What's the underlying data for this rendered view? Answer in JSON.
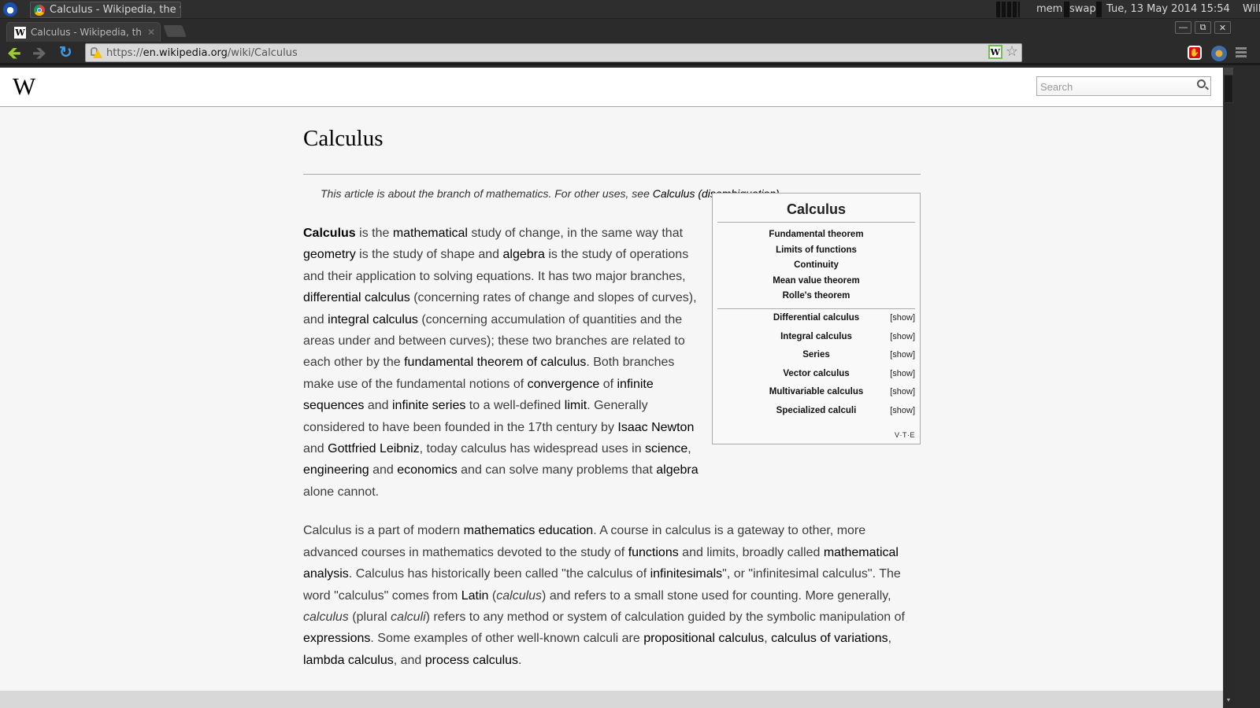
{
  "system_panel": {
    "taskbar_window_title": "Calculus - Wikipedia, the fr...",
    "mem_label": "mem",
    "swap_label": "swap",
    "clock": "Tue, 13 May 2014 15:54",
    "user": "Will"
  },
  "browser": {
    "tab_title": "Calculus - Wikipedia, the fr",
    "url_scheme": "https://",
    "url_domain": "en.wikipedia.org",
    "url_path": "/wiki/Calculus",
    "favicon_letter": "W",
    "extension_letter": "W"
  },
  "wiki": {
    "logo": "W",
    "search_placeholder": "Search",
    "title": "Calculus",
    "hatnote": {
      "prefix": "This article is about the branch of mathematics. For other uses, see ",
      "link": "Calculus (disambiguation)",
      "suffix": "."
    },
    "infobox": {
      "title": "Calculus",
      "top_items": [
        "Fundamental theorem",
        "Limits of functions",
        "Continuity",
        "Mean value theorem",
        "Rolle's theorem"
      ],
      "sections": [
        {
          "label": "Differential calculus",
          "toggle": "[show]"
        },
        {
          "label": "Integral calculus",
          "toggle": "[show]"
        },
        {
          "label": "Series",
          "toggle": "[show]"
        },
        {
          "label": "Vector calculus",
          "toggle": "[show]"
        },
        {
          "label": "Multivariable calculus",
          "toggle": "[show]"
        },
        {
          "label": "Specialized calculi",
          "toggle": "[show]"
        }
      ],
      "vte": "V·T·E"
    },
    "paragraph1": [
      {
        "t": "Calculus",
        "b": true
      },
      {
        "t": " is the "
      },
      {
        "t": "mathematical",
        "a": true
      },
      {
        "t": " study of change, in the same way that "
      },
      {
        "t": "geometry",
        "a": true
      },
      {
        "t": " is the study of shape and "
      },
      {
        "t": "algebra",
        "a": true
      },
      {
        "t": " is the study of operations and their application to solving equations. It has two major branches, "
      },
      {
        "t": "differential calculus",
        "a": true
      },
      {
        "t": " (concerning rates of change and slopes of curves), and "
      },
      {
        "t": "integral calculus",
        "a": true
      },
      {
        "t": " (concerning accumulation of quantities and the areas under and between curves); these two branches are related to each other by the "
      },
      {
        "t": "fundamental theorem of calculus",
        "a": true
      },
      {
        "t": ". Both branches make use of the fundamental notions of "
      },
      {
        "t": "convergence",
        "a": true
      },
      {
        "t": " of "
      },
      {
        "t": "infinite sequences",
        "a": true
      },
      {
        "t": " and "
      },
      {
        "t": "infinite series",
        "a": true
      },
      {
        "t": " to a well-defined "
      },
      {
        "t": "limit",
        "a": true
      },
      {
        "t": ". Generally considered to have been founded in the 17th century by "
      },
      {
        "t": "Isaac Newton",
        "a": true
      },
      {
        "t": " and "
      },
      {
        "t": "Gottfried Leibniz",
        "a": true
      },
      {
        "t": ", today calculus has widespread uses in "
      },
      {
        "t": "science",
        "a": true
      },
      {
        "t": ", "
      },
      {
        "t": "engineering",
        "a": true
      },
      {
        "t": " and "
      },
      {
        "t": "economics",
        "a": true
      },
      {
        "t": " and can solve many problems that "
      },
      {
        "t": "algebra",
        "a": true
      },
      {
        "t": " alone cannot."
      }
    ],
    "paragraph2": [
      {
        "t": "Calculus is a part of modern "
      },
      {
        "t": "mathematics education",
        "a": true
      },
      {
        "t": ". A course in calculus is a gateway to other, more advanced courses in mathematics devoted to the study of "
      },
      {
        "t": "functions",
        "a": true
      },
      {
        "t": " and limits, broadly called "
      },
      {
        "t": "mathematical analysis",
        "a": true
      },
      {
        "t": ". Calculus has historically been called \"the calculus of "
      },
      {
        "t": "infinitesimals",
        "a": true
      },
      {
        "t": "\", or \"infinitesimal calculus\". The word \"calculus\" comes from "
      },
      {
        "t": "Latin",
        "a": true
      },
      {
        "t": " ("
      },
      {
        "t": "calculus",
        "i": true
      },
      {
        "t": ") and refers to a small stone used for counting. More generally, "
      },
      {
        "t": "calculus",
        "i": true
      },
      {
        "t": " (plural "
      },
      {
        "t": "calculi",
        "i": true
      },
      {
        "t": ") refers to any method or system of calculation guided by the symbolic manipulation of "
      },
      {
        "t": "expressions",
        "a": true
      },
      {
        "t": ". Some examples of other well-known calculi are "
      },
      {
        "t": "propositional calculus",
        "a": true
      },
      {
        "t": ", "
      },
      {
        "t": "calculus of variations",
        "a": true
      },
      {
        "t": ", "
      },
      {
        "t": "lambda calculus",
        "a": true
      },
      {
        "t": ", and "
      },
      {
        "t": "process calculus",
        "a": true
      },
      {
        "t": "."
      }
    ]
  }
}
